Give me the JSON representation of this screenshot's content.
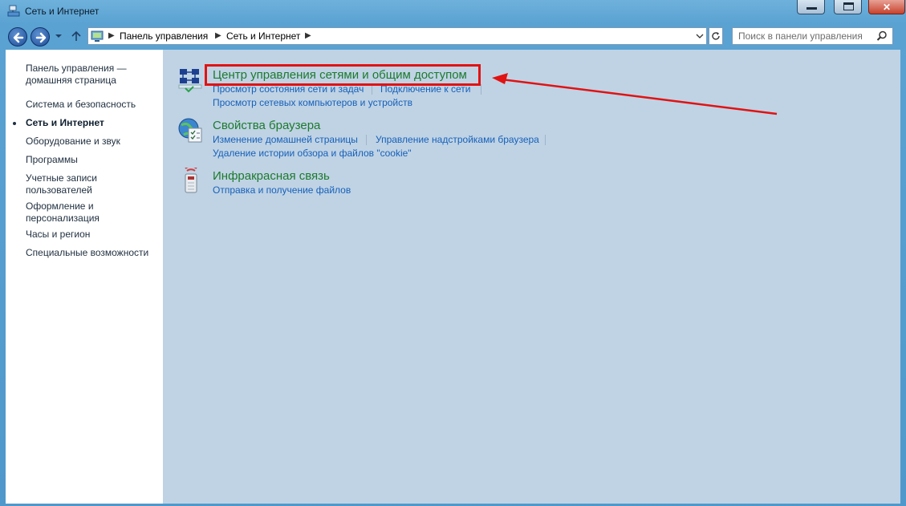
{
  "window": {
    "title": "Сеть и Интернет",
    "controls": {
      "minimize": "minimize",
      "maximize": "maximize",
      "close": "✕"
    }
  },
  "address": {
    "crumbs": [
      "Панель управления",
      "Сеть и Интернет"
    ]
  },
  "search": {
    "placeholder": "Поиск в панели управления"
  },
  "sidebar": {
    "items": [
      {
        "label": "Панель управления — домашняя страница"
      },
      {
        "label": "Система и безопасность"
      },
      {
        "label": "Сеть и Интернет",
        "active": true
      },
      {
        "label": "Оборудование и звук"
      },
      {
        "label": "Программы"
      },
      {
        "label": "Учетные записи пользователей"
      },
      {
        "label": "Оформление и персонализация"
      },
      {
        "label": "Часы и регион"
      },
      {
        "label": "Специальные возможности"
      }
    ]
  },
  "categories": [
    {
      "title": "Центр управления сетями и общим доступом",
      "icon": "network-center-icon",
      "links": [
        "Просмотр состояния сети и задач",
        "Подключение к сети",
        "Просмотр сетевых компьютеров и устройств"
      ]
    },
    {
      "title": "Свойства браузера",
      "icon": "internet-options-icon",
      "links": [
        "Изменение домашней страницы",
        "Управление надстройками браузера",
        "Удаление истории обзора и файлов \"cookie\""
      ]
    },
    {
      "title": "Инфракрасная связь",
      "icon": "infrared-icon",
      "links": [
        "Отправка и получение файлов"
      ]
    }
  ],
  "colors": {
    "accent_highlight": "#e11212",
    "category_title": "#1d7a2c",
    "link": "#1760b8",
    "content_bg": "#bfd3e5"
  }
}
